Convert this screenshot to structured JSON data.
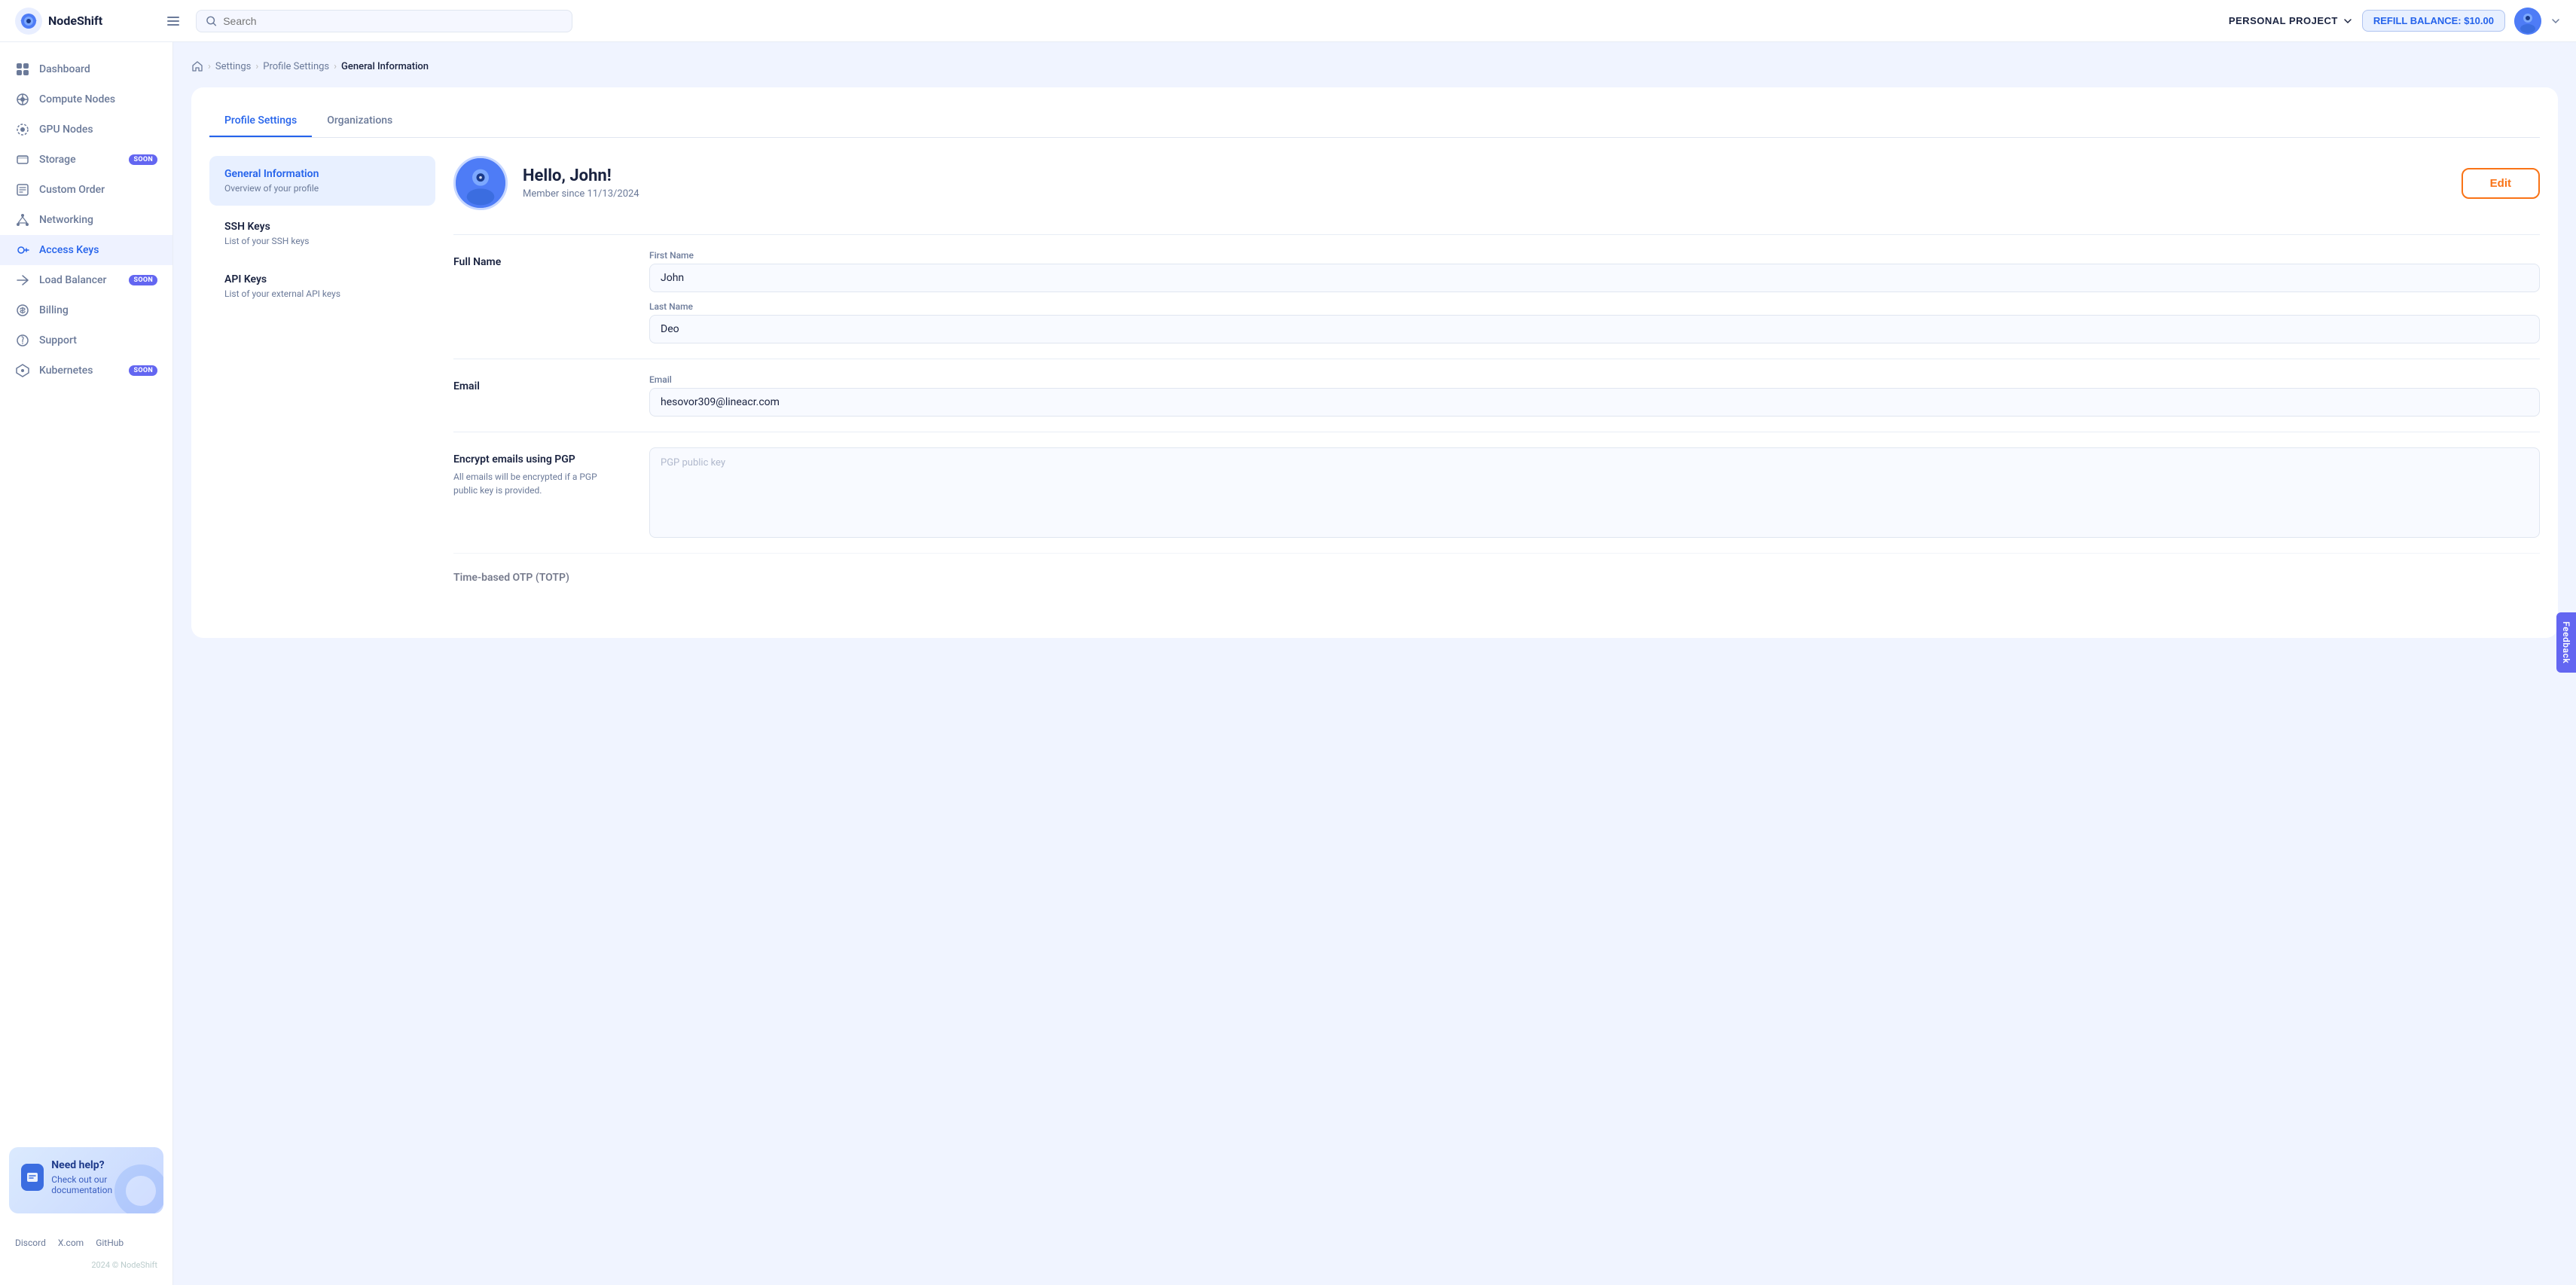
{
  "topbar": {
    "logo_text": "NodeShift",
    "search_placeholder": "Search",
    "project_label": "PERSONAL PROJECT",
    "refill_label": "REFILL BALANCE: $10.00"
  },
  "sidebar": {
    "items": [
      {
        "id": "dashboard",
        "label": "Dashboard",
        "soon": false
      },
      {
        "id": "compute-nodes",
        "label": "Compute Nodes",
        "soon": false
      },
      {
        "id": "gpu-nodes",
        "label": "GPU Nodes",
        "soon": false
      },
      {
        "id": "storage",
        "label": "Storage",
        "soon": true
      },
      {
        "id": "custom-order",
        "label": "Custom Order",
        "soon": false
      },
      {
        "id": "networking",
        "label": "Networking",
        "soon": false
      },
      {
        "id": "access-keys",
        "label": "Access Keys",
        "soon": false,
        "active": true
      },
      {
        "id": "load-balancer",
        "label": "Load Balancer",
        "soon": true
      },
      {
        "id": "billing",
        "label": "Billing",
        "soon": false
      },
      {
        "id": "support",
        "label": "Support",
        "soon": false
      },
      {
        "id": "kubernetes",
        "label": "Kubernetes",
        "soon": true
      }
    ],
    "help_title": "Need help?",
    "help_sub": "Check out our documentation",
    "soon_label": "SOON"
  },
  "footer": {
    "links": [
      "Discord",
      "X.com",
      "GitHub"
    ],
    "copyright": "2024 © NodeShift"
  },
  "breadcrumb": {
    "home": "home",
    "settings": "Settings",
    "profile_settings": "Profile Settings",
    "current": "General Information"
  },
  "tabs": [
    {
      "label": "Profile Settings",
      "active": true
    },
    {
      "label": "Organizations",
      "active": false
    }
  ],
  "profile_nav": [
    {
      "id": "general",
      "title": "General Information",
      "sub": "Overview of your profile",
      "active": true
    },
    {
      "id": "ssh-keys",
      "title": "SSH Keys",
      "sub": "List of your SSH keys",
      "active": false
    },
    {
      "id": "api-keys",
      "title": "API Keys",
      "sub": "List of your external API keys",
      "active": false
    }
  ],
  "profile": {
    "greeting": "Hello, John!",
    "member_since": "Member since 11/13/2024",
    "edit_label": "Edit",
    "full_name_label": "Full Name",
    "first_name_label": "First Name",
    "first_name_value": "John",
    "last_name_label": "Last Name",
    "last_name_value": "Deo",
    "email_label": "Email",
    "email_field_label": "Email",
    "email_value": "hesovor309@lineacr.com",
    "pgp_label": "Encrypt emails using PGP",
    "pgp_sub": "All emails will be encrypted if a PGP public key is provided.",
    "pgp_placeholder": "PGP public key",
    "totp_label": "Time-based OTP (TOTP)"
  },
  "feedback": {
    "label": "Feedback"
  }
}
